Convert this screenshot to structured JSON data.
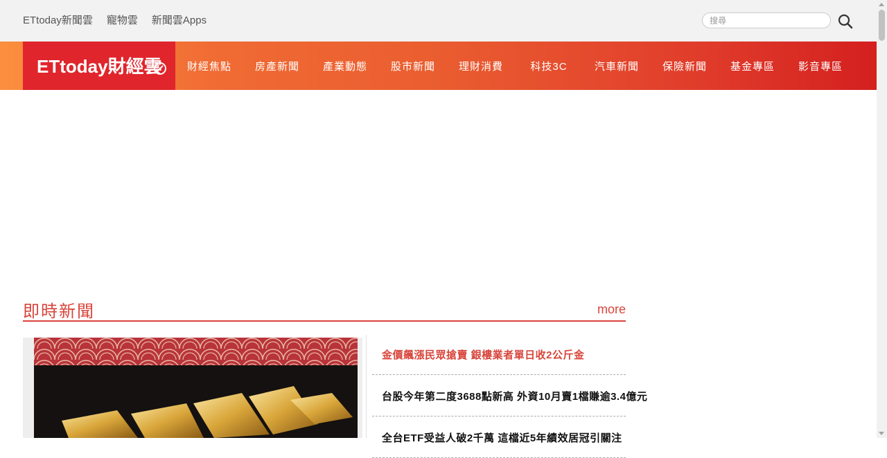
{
  "header": {
    "links": [
      {
        "label": "ETtoday新聞雲"
      },
      {
        "label": "寵物雲"
      },
      {
        "label": "新聞雲Apps"
      }
    ],
    "search": {
      "placeholder": "搜尋"
    }
  },
  "logo": {
    "text": "ETtoday財經雲"
  },
  "nav": {
    "items": [
      {
        "label": "財經焦點"
      },
      {
        "label": "房產新聞"
      },
      {
        "label": "產業動態"
      },
      {
        "label": "股市新聞"
      },
      {
        "label": "理財消費"
      },
      {
        "label": "科技3C"
      },
      {
        "label": "汽車新聞"
      },
      {
        "label": "保險新聞"
      },
      {
        "label": "基金專區"
      },
      {
        "label": "影音專區"
      }
    ]
  },
  "section": {
    "title": "即時新聞",
    "more_label": "more"
  },
  "headlines": [
    {
      "title": "金價飆漲民眾搶賣   銀樓業者單日收2公斤金"
    },
    {
      "title": "台股今年第二度3688點新高   外資10月賣1檔賺逾3.4億元"
    },
    {
      "title": "全台ETF受益人破2千萬   這檔近5年績效居冠引關注"
    }
  ],
  "colors": {
    "accent": "#d8443a",
    "logo_bg": "#e0252c",
    "nav_start": "#fb8f3f",
    "nav_end": "#d4201f"
  }
}
